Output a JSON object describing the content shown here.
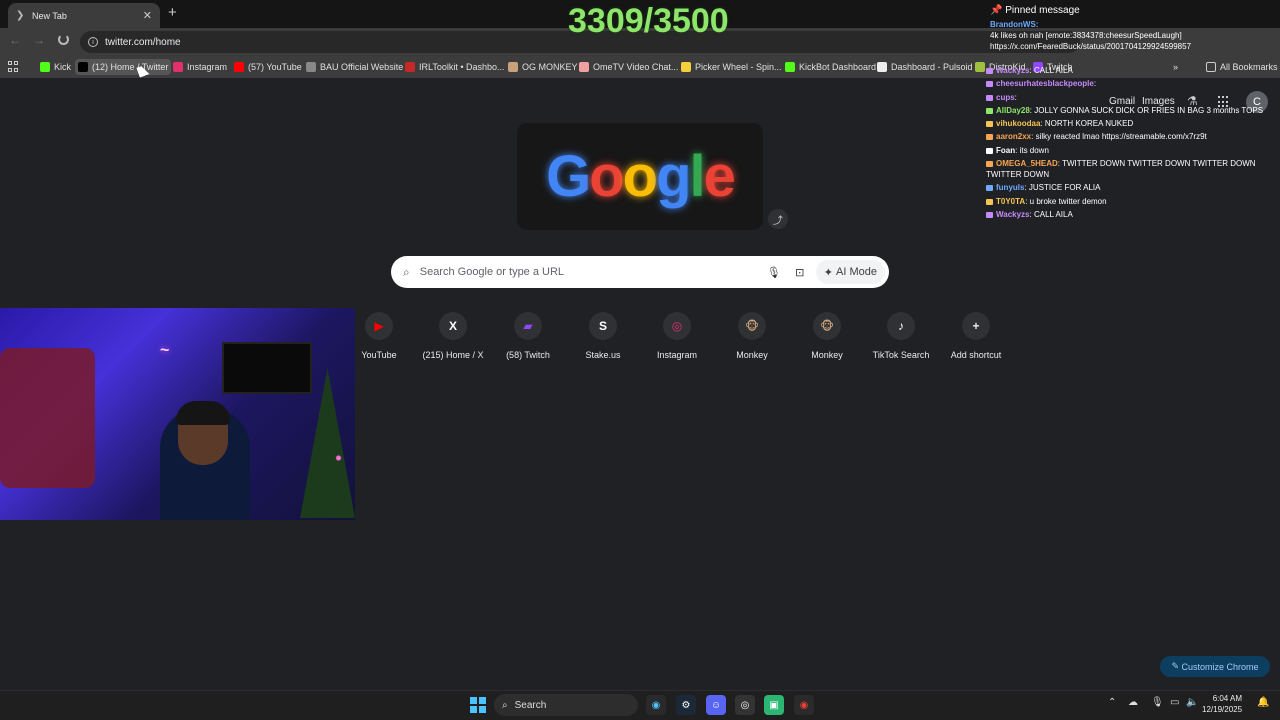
{
  "browser": {
    "tab_title": "New Tab",
    "url": "twitter.com/home",
    "bookmarks": [
      {
        "label": "Kick",
        "icon": "kick-icon",
        "color": "#53fc18"
      },
      {
        "label": "(12) Home / Twitter",
        "icon": "x-icon",
        "color": "#000000"
      },
      {
        "label": "Instagram",
        "icon": "instagram-icon",
        "color": "#e1306c"
      },
      {
        "label": "(57) YouTube",
        "icon": "youtube-icon",
        "color": "#ff0000"
      },
      {
        "label": "BAU Official Website",
        "icon": "bau-icon",
        "color": "#888888"
      },
      {
        "label": "IRLToolkit • Dashbo...",
        "icon": "irltoolkit-icon",
        "color": "#c62828"
      },
      {
        "label": "OG MONKEY",
        "icon": "monkey-icon",
        "color": "#c9a17a"
      },
      {
        "label": "OmeTV Video Chat...",
        "icon": "ometv-icon",
        "color": "#f0a0a0"
      },
      {
        "label": "Picker Wheel - Spin...",
        "icon": "picker-wheel-icon",
        "color": "#f4d03f"
      },
      {
        "label": "KickBot Dashboard",
        "icon": "kickbot-icon",
        "color": "#53fc18"
      },
      {
        "label": "Dashboard - Pulsoid",
        "icon": "pulsoid-icon",
        "color": "#eeeeee"
      },
      {
        "label": "DistroKid",
        "icon": "distrokid-icon",
        "color": "#a0c040"
      },
      {
        "label": "Twitch",
        "icon": "twitch-icon",
        "color": "#9146ff"
      }
    ],
    "all_bookmarks": "All Bookmarks"
  },
  "overlay": {
    "counter": "3309/3500"
  },
  "google": {
    "logo_text": "Google",
    "search_placeholder": "Search Google or type a URL",
    "ai_mode": "AI Mode",
    "gmail": "Gmail",
    "images": "Images",
    "avatar_letter": "C",
    "shortcuts": [
      {
        "label": "YouTube",
        "glyph": "▶",
        "color": "#ff0000"
      },
      {
        "label": "(215) Home / X",
        "glyph": "X",
        "color": "#ffffff"
      },
      {
        "label": "(58) Twitch",
        "glyph": "▰",
        "color": "#9146ff"
      },
      {
        "label": "Stake.us",
        "glyph": "S",
        "color": "#ffffff"
      },
      {
        "label": "Instagram",
        "glyph": "◎",
        "color": "#e1306c"
      },
      {
        "label": "Monkey",
        "glyph": "🐵",
        "color": "#c9a17a"
      },
      {
        "label": "Monkey",
        "glyph": "🐵",
        "color": "#c9a17a"
      },
      {
        "label": "TikTok Search",
        "glyph": "♪",
        "color": "#ffffff"
      },
      {
        "label": "Add shortcut",
        "glyph": "+",
        "color": "#e8eaed"
      }
    ],
    "customize": "Customize Chrome"
  },
  "chat": {
    "pinned_title": "Pinned message",
    "pinned_user": "BrandonWS:",
    "pinned_msg1": "4k likes oh nah [emote:3834378:cheesurSpeedLaugh]",
    "pinned_msg2": "https://x.com/FearedBuck/status/2001704129924599857",
    "messages": [
      {
        "user": "Wackyzs",
        "text": "CALL AILA",
        "color": "#c58af9"
      },
      {
        "user": "cheesurhatesblackpeople",
        "text": "",
        "color": "#c58af9"
      },
      {
        "user": "cups",
        "text": "",
        "color": "#c58af9"
      },
      {
        "user": "AllDay28",
        "text": "JOLLY GONNA SUCK DICK OR FRIES IN BAG 3 months TOPS",
        "color": "#8ee56b"
      },
      {
        "user": "vihukoodaa",
        "text": "NORTH KOREA NUKED",
        "color": "#f6c453"
      },
      {
        "user": "aaron2xx",
        "text": "silky reacted lmao https://streamable.com/x7rz9t",
        "color": "#f6a553"
      },
      {
        "user": "Foan",
        "text": "its down",
        "color": "#ffffff"
      },
      {
        "user": "OMEGA_5HEAD",
        "text": "TWITTER DOWN TWITTER DOWN TWITTER DOWN",
        "color": "#f6a553"
      },
      {
        "user": "",
        "text": "TWITTER DOWN",
        "color": "#ffffff"
      },
      {
        "user": "funyuls",
        "text": "JUSTICE FOR ALIA",
        "color": "#6ea8ff"
      },
      {
        "user": "T0Y0TA",
        "text": "u broke twitter demon",
        "color": "#f6c453"
      },
      {
        "user": "Wackyzs",
        "text": "CALL AILA",
        "color": "#c58af9"
      }
    ]
  },
  "taskbar": {
    "search": "Search",
    "time": "6:04 AM",
    "date": "12/19/2025"
  }
}
